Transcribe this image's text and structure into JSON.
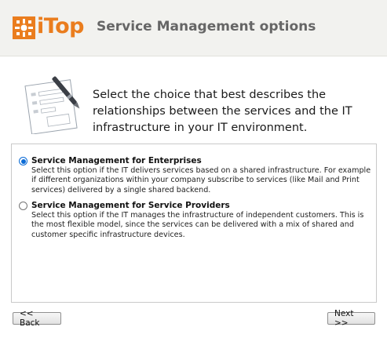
{
  "header": {
    "logo_text": "iTop",
    "title": "Service Management options",
    "brand_color": "#ea7d1e"
  },
  "intro": {
    "icon": "form-with-pen-icon",
    "text": "Select the choice that best describes the relationships between the services and the IT infrastructure in your IT environment."
  },
  "options": [
    {
      "title": "Service Management for Enterprises",
      "description": "Select this option if the IT delivers services based on a shared infrastructure. For example if different organizations within your company subscribe to services (like Mail and Print services) delivered by a single shared backend.",
      "selected": true
    },
    {
      "title": "Service Management for Service Providers",
      "description": "Select this option if the IT manages the infrastructure of independent customers. This is the most flexible model, since the services can be delivered with a mix of shared and customer specific infrastructure devices.",
      "selected": false
    }
  ],
  "buttons": {
    "back_label": "<< Back",
    "next_label": "Next >>"
  },
  "colors": {
    "radio_selected": "#0b6bd6",
    "header_bg": "#f2f2ef"
  }
}
